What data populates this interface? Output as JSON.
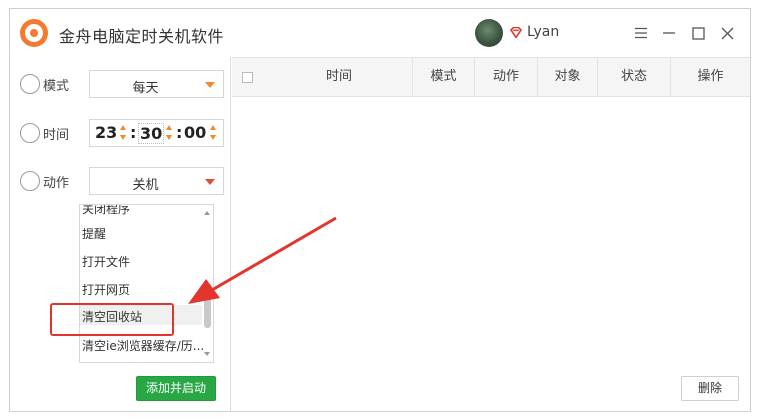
{
  "app": {
    "title": "金舟电脑定时关机软件",
    "username": "Lyan"
  },
  "titlebar_buttons": {
    "menu": "☰",
    "minimize": "—",
    "maximize": "☐",
    "close": "✕"
  },
  "form": {
    "mode_label": "模式",
    "mode_value": "每天",
    "time_label": "时间",
    "time": {
      "hour": "23",
      "minute": "30",
      "second": "00"
    },
    "action_label": "动作",
    "action_value": "关机"
  },
  "dropdown": {
    "items": [
      "关闭程序",
      "提醒",
      "打开文件",
      "打开网页",
      "清空回收站",
      "清空ie浏览器缓存/历..."
    ],
    "highlighted": "清空回收站"
  },
  "add_button": "添加并启动",
  "table": {
    "columns": [
      "时间",
      "模式",
      "动作",
      "对象",
      "状态",
      "操作"
    ]
  },
  "delete_button": "删除",
  "colors": {
    "accent_orange": "#f08b2c",
    "primary_green": "#28a745",
    "annotation_red": "#e3352e"
  }
}
